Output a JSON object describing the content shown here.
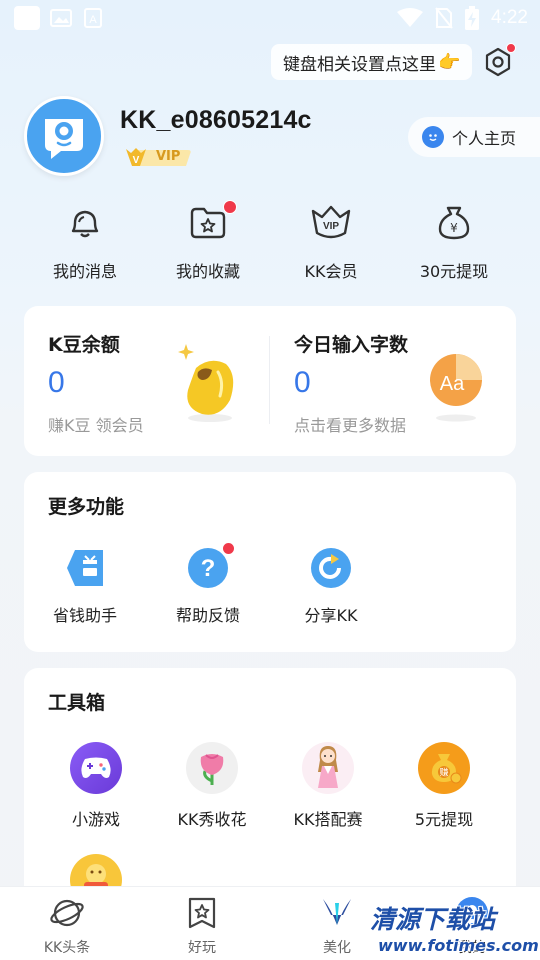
{
  "status_bar": {
    "time": "4:22"
  },
  "keyboard_tip": {
    "label": "键盘相关设置点这里",
    "hand": "👉"
  },
  "profile": {
    "username": "KK_e08605214c",
    "vip_label": "VIP",
    "home_button": "个人主页"
  },
  "quick_actions": [
    {
      "label": "我的消息",
      "icon": "bell-icon"
    },
    {
      "label": "我的收藏",
      "icon": "folder-star-icon",
      "badge": true
    },
    {
      "label": "KK会员",
      "icon": "vip-crown-icon"
    },
    {
      "label": "30元提现",
      "icon": "money-bag-icon"
    }
  ],
  "stats": {
    "kbeans": {
      "title": "K豆余额",
      "value": "0",
      "subtitle": "赚K豆 领会员"
    },
    "typing": {
      "title": "今日输入字数",
      "value": "0",
      "subtitle": "点击看更多数据"
    }
  },
  "more_features": {
    "title": "更多功能",
    "items": [
      {
        "label": "省钱助手",
        "icon": "coupon-icon"
      },
      {
        "label": "帮助反馈",
        "icon": "help-icon",
        "badge": true
      },
      {
        "label": "分享KK",
        "icon": "share-icon"
      }
    ]
  },
  "toolbox": {
    "title": "工具箱",
    "items": [
      {
        "label": "小游戏",
        "icon": "gamepad-icon"
      },
      {
        "label": "KK秀收花",
        "icon": "flower-icon"
      },
      {
        "label": "KK搭配赛",
        "icon": "dressup-girl-icon"
      },
      {
        "label": "5元提现",
        "icon": "money-bag-icon"
      },
      {
        "label": "",
        "icon": "red-packet-icon"
      }
    ]
  },
  "tabs": [
    {
      "label": "KK头条",
      "icon": "planet-icon"
    },
    {
      "label": "好玩",
      "icon": "bookmark-star-icon"
    },
    {
      "label": "美化",
      "icon": "paint-icon"
    },
    {
      "label": "我的",
      "icon": "profile-icon",
      "active": true
    }
  ],
  "watermark": {
    "cn": "清源下载站",
    "en": "www.fotimes.com"
  },
  "colors": {
    "accent": "#3777e8",
    "badge": "#f0394a",
    "vip_gold": "#d79a1e"
  }
}
